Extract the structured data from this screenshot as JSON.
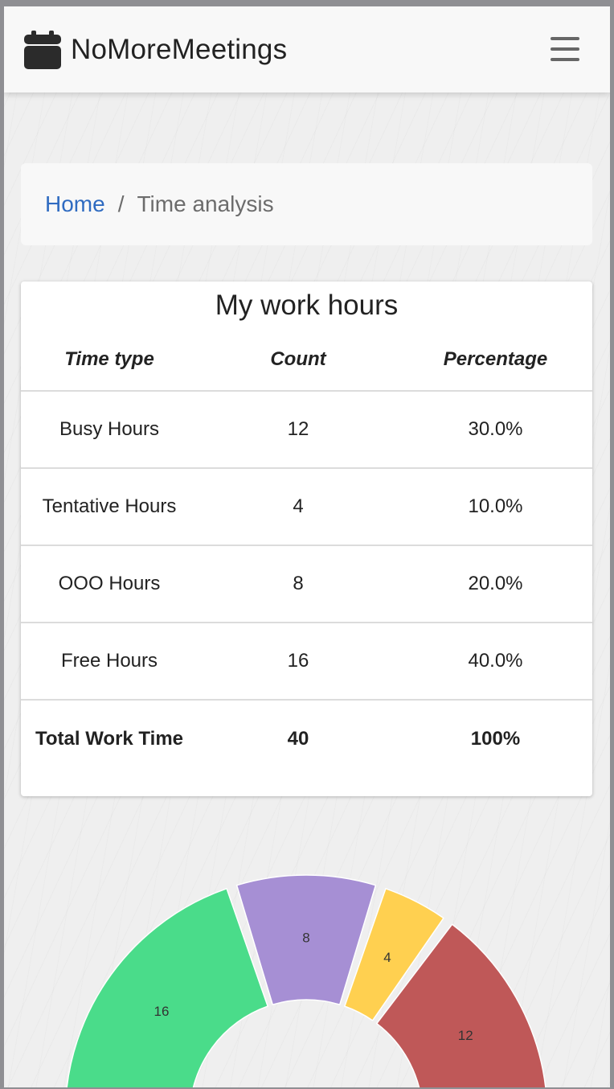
{
  "navbar": {
    "brand": "NoMoreMeetings",
    "brand_icon": "calendar-icon",
    "menu_icon": "hamburger-menu-icon"
  },
  "breadcrumb": {
    "home": "Home",
    "separator": "/",
    "current": "Time analysis"
  },
  "work_hours": {
    "title": "My work hours",
    "columns": [
      "Time type",
      "Count",
      "Percentage"
    ],
    "rows": [
      {
        "type": "Busy Hours",
        "count": "12",
        "percentage": "30.0%"
      },
      {
        "type": "Tentative Hours",
        "count": "4",
        "percentage": "10.0%"
      },
      {
        "type": "OOO Hours",
        "count": "8",
        "percentage": "20.0%"
      },
      {
        "type": "Free Hours",
        "count": "16",
        "percentage": "40.0%"
      }
    ],
    "total": {
      "type": "Total Work Time",
      "count": "40",
      "percentage": "100%"
    }
  },
  "chart_data": {
    "type": "pie",
    "variant": "semi-doughnut",
    "categories": [
      "Free Hours",
      "OOO Hours",
      "Tentative Hours",
      "Busy Hours"
    ],
    "values": [
      16,
      8,
      4,
      12
    ],
    "colors": [
      "#4adc8a",
      "#a68fd4",
      "#ffd050",
      "#bf5858"
    ],
    "data_labels": [
      "16",
      "8",
      "4",
      "12"
    ]
  }
}
